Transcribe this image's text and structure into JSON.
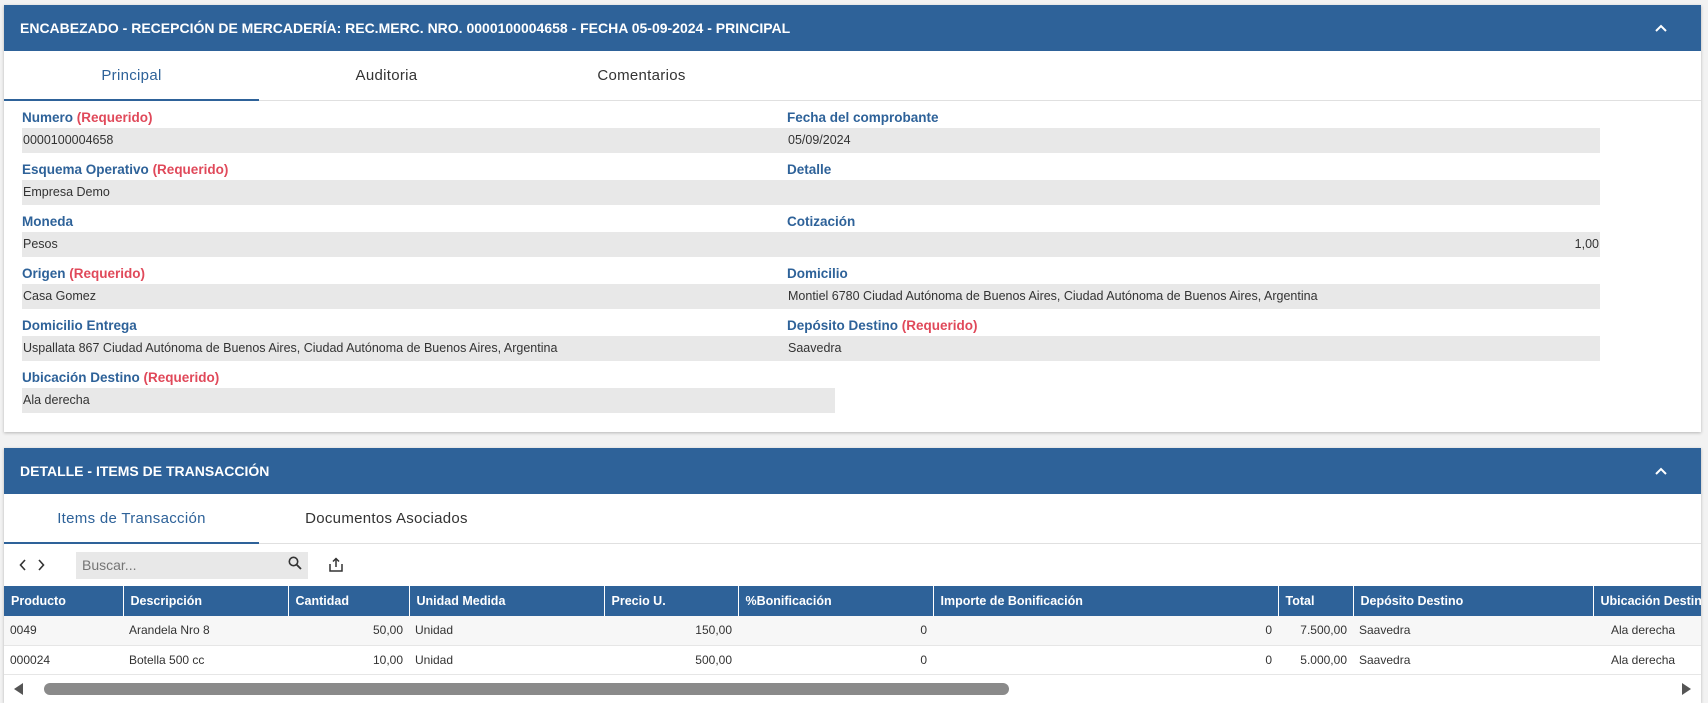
{
  "header": {
    "title": "ENCABEZADO - RECEPCIÓN DE MERCADERÍA: REC.MERC. NRO. 0000100004658 - FECHA 05-09-2024 - PRINCIPAL",
    "collapse_icon": "chevron-up-icon"
  },
  "tabs1": [
    "Principal",
    "Auditoria",
    "Comentarios"
  ],
  "required_label": "(Requerido)",
  "fields": {
    "numero": {
      "label": "Numero",
      "value": "0000100004658"
    },
    "fecha": {
      "label": "Fecha del comprobante",
      "value": "05/09/2024"
    },
    "esquema": {
      "label": "Esquema Operativo",
      "value": "Empresa Demo"
    },
    "detalle": {
      "label": "Detalle",
      "value": ""
    },
    "moneda": {
      "label": "Moneda",
      "value": "Pesos"
    },
    "cotizacion": {
      "label": "Cotización",
      "value": "1,00"
    },
    "origen": {
      "label": "Origen",
      "value": "Casa Gomez"
    },
    "domicilio": {
      "label": "Domicilio",
      "value": "Montiel 6780  Ciudad Autónoma de Buenos Aires, Ciudad Autónoma de Buenos Aires, Argentina"
    },
    "domicilio_entrega": {
      "label": "Domicilio Entrega",
      "value": "Uspallata 867  Ciudad Autónoma de Buenos Aires, Ciudad Autónoma de Buenos Aires, Argentina"
    },
    "deposito": {
      "label": "Depósito Destino",
      "value": "Saavedra"
    },
    "ubicacion": {
      "label": "Ubicación Destino",
      "value": "Ala derecha"
    }
  },
  "detail": {
    "title": "DETALLE - ITEMS DE TRANSACCIÓN",
    "tabs": [
      "Items de Transacción",
      "Documentos Asociados"
    ],
    "search_placeholder": "Buscar...",
    "columns": [
      "Producto",
      "Descripción",
      "Cantidad",
      "Unidad Medida",
      "Precio U.",
      "%Bonificación",
      "Importe de Bonificación",
      "Total",
      "Depósito Destino",
      "Ubicación Destino"
    ],
    "rows": [
      [
        "0049",
        "Arandela Nro 8",
        "50,00",
        "Unidad",
        "150,00",
        "0",
        "0",
        "7.500,00",
        "Saavedra",
        "Ala derecha"
      ],
      [
        "000024",
        "Botella 500 cc",
        "10,00",
        "Unidad",
        "500,00",
        "0",
        "0",
        "5.000,00",
        "Saavedra",
        "Ala derecha"
      ]
    ]
  },
  "colors": {
    "header_bg": "#2e6299",
    "label": "#2e6299",
    "required": "#e0495a",
    "field_bg": "#e8e8e8"
  }
}
